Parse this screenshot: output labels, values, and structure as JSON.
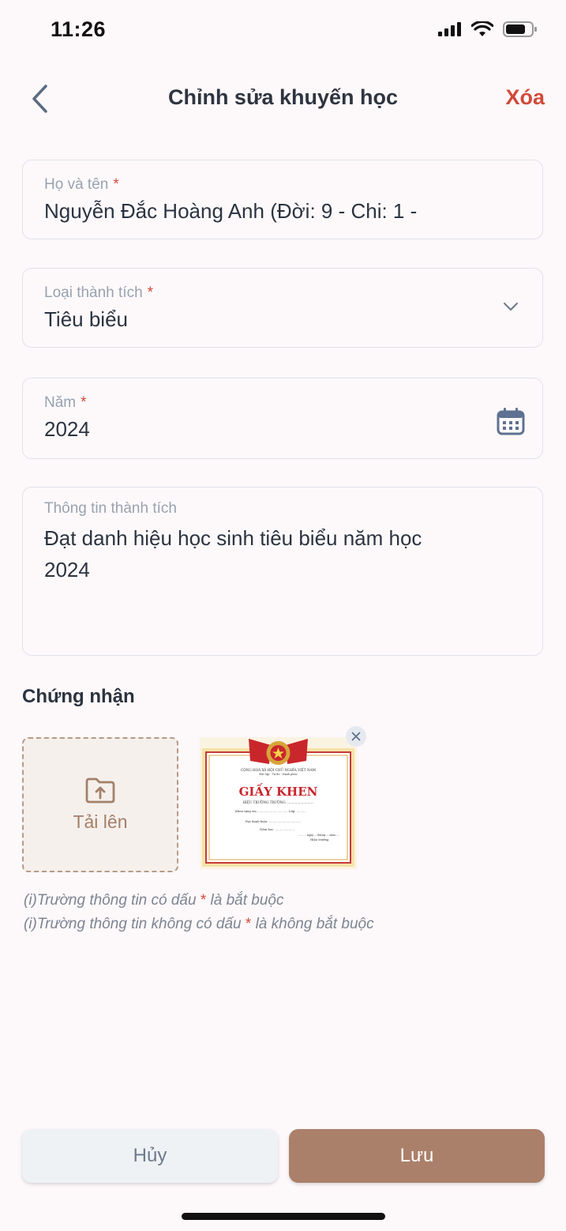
{
  "status_bar": {
    "time": "11:26"
  },
  "header": {
    "title": "Chỉnh sửa khuyến học",
    "delete_label": "Xóa"
  },
  "form": {
    "name": {
      "label": "Họ và tên",
      "required_mark": "*",
      "value": "Nguyễn Đắc Hoàng Anh (Đời: 9 - Chi: 1 -"
    },
    "achievement_type": {
      "label": "Loại thành tích",
      "required_mark": "*",
      "value": "Tiêu biểu"
    },
    "year": {
      "label": "Năm",
      "required_mark": "*",
      "value": "2024"
    },
    "achievement_info": {
      "label": "Thông tin thành tích",
      "value": "Đạt danh hiệu học sinh tiêu biểu năm học 2024"
    }
  },
  "certification": {
    "title": "Chứng nhận",
    "upload_label": "Tải lên",
    "certificate": {
      "header_line": "CỘNG HOÀ XÃ HỘI CHỦ NGHĨA VIỆT NAM",
      "sub_line": "Độc lập - Tự do - Hạnh phúc",
      "title": "GIẤY KHEN",
      "issuer": "HIỆU TRƯỞNG TRƯỜNG ..........................",
      "line1": "Khen tặng em ................................ Lớp: ..........",
      "line2": "Đạt danh hiệu: ..................................",
      "line3": "Năm học: ....................",
      "date_line": "........, ngày.... tháng.... năm.....",
      "signer": "Hiệu trưởng"
    }
  },
  "notes": {
    "required_prefix": "(i)Trường thông tin có dấu",
    "required_suffix": "là bắt buộc",
    "optional_prefix": "(i)Trường thông tin không có dấu",
    "optional_suffix": "là không bắt buộc",
    "mark": "*"
  },
  "buttons": {
    "cancel": "Hủy",
    "save": "Lưu"
  },
  "colors": {
    "accent": "#ab806a",
    "danger": "#d14a3a",
    "background": "#fdf8fa"
  }
}
